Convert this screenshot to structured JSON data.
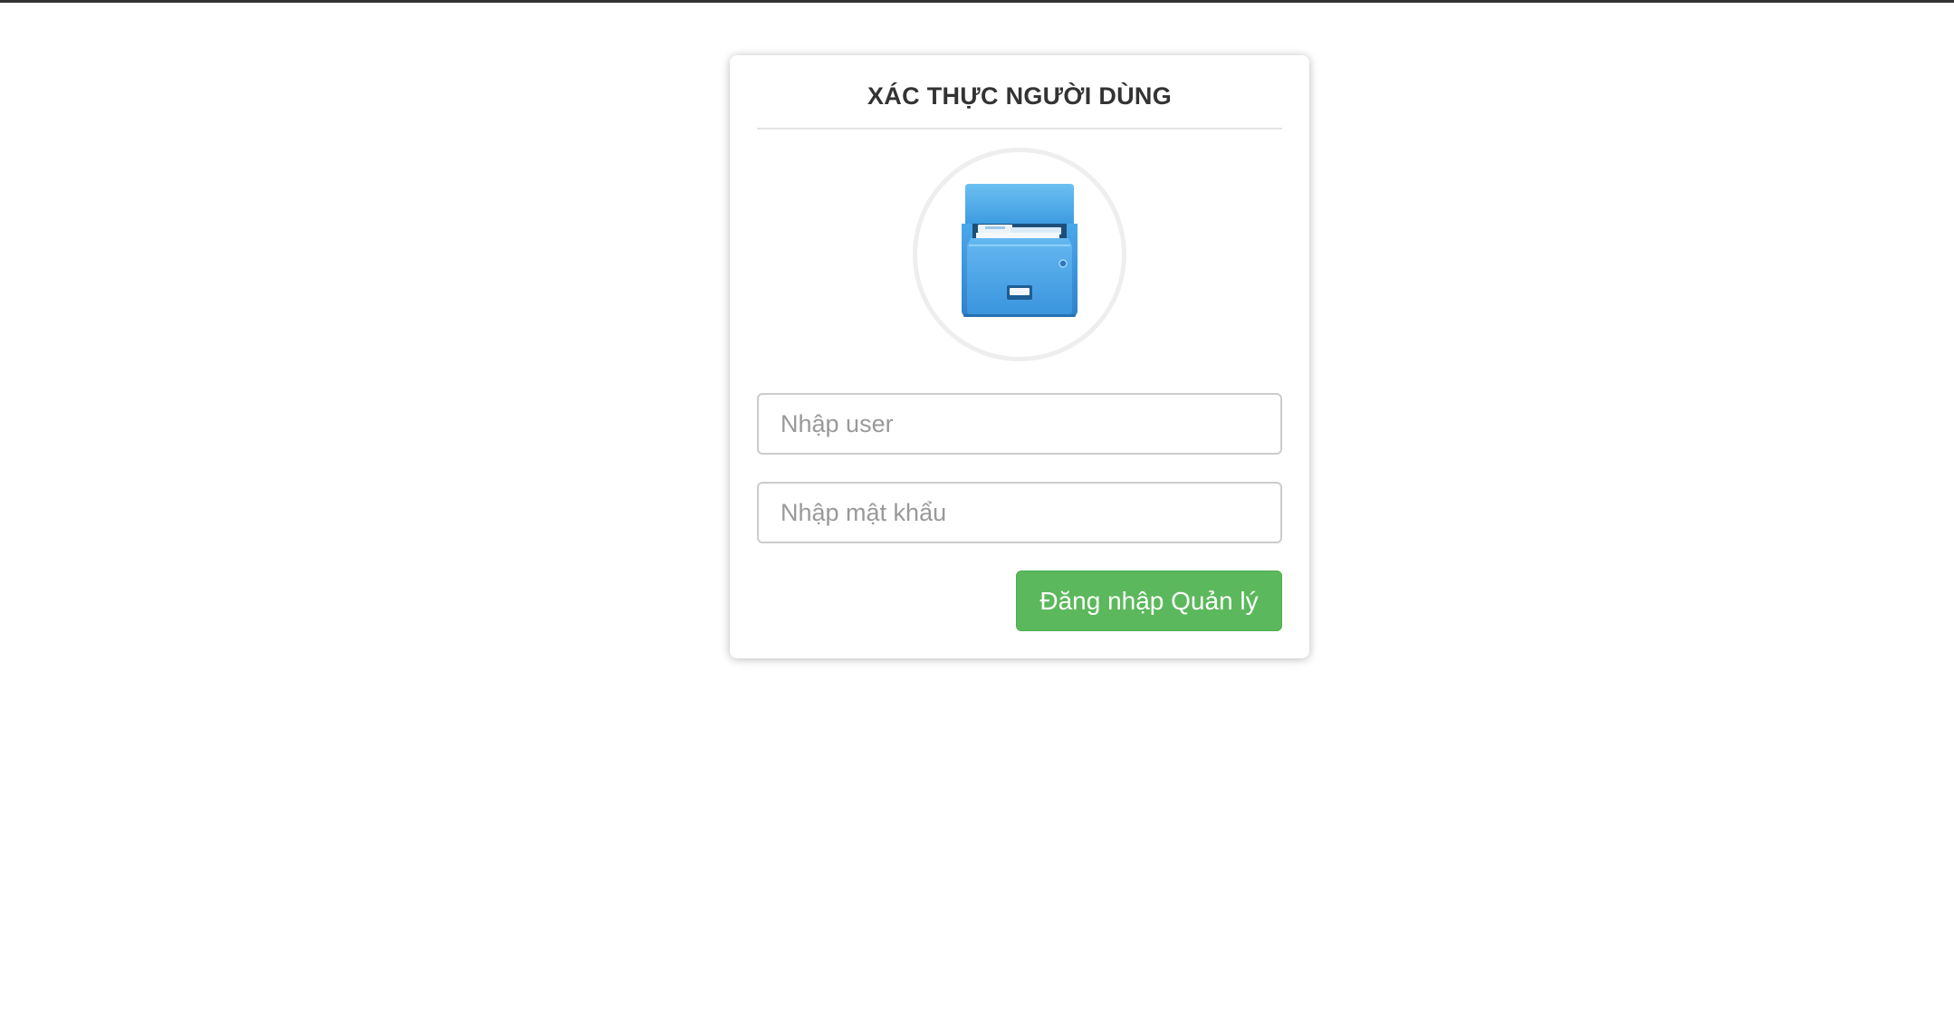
{
  "login_card": {
    "title": "XÁC THỰC NGƯỜI DÙNG",
    "logo_icon": "file-cabinet-icon",
    "user_field": {
      "value": "",
      "placeholder": "Nhập user"
    },
    "password_field": {
      "value": "",
      "placeholder": "Nhập mật khẩu"
    },
    "login_button_label": "Đăng nhập Quản lý"
  },
  "colors": {
    "primary_button": "#5cb85c",
    "icon_blue": "#3d9be0",
    "title_text": "#333333"
  }
}
